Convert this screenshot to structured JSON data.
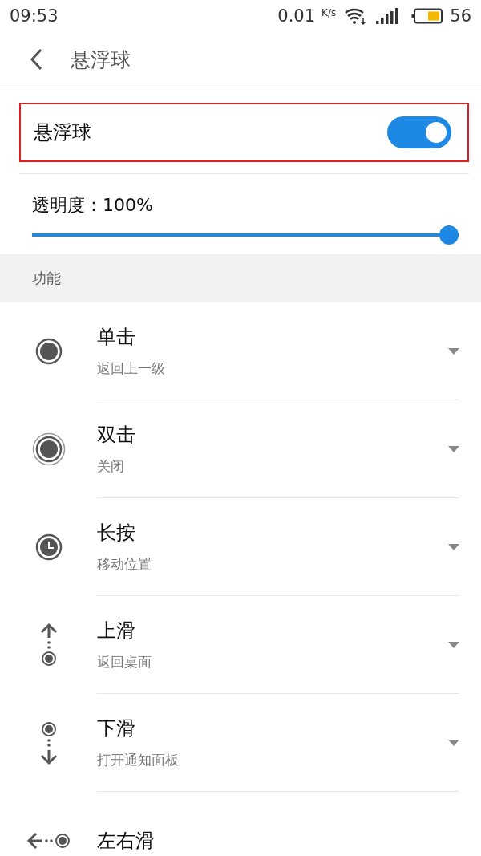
{
  "status_bar": {
    "time": "09:53",
    "speed": "0.01",
    "speed_unit": "K/s",
    "battery": "56"
  },
  "header": {
    "title": "悬浮球"
  },
  "toggle": {
    "label": "悬浮球",
    "on": true,
    "outlined": true
  },
  "opacity": {
    "label": "透明度：100%",
    "level": 1
  },
  "section": {
    "title": "功能"
  },
  "items": [
    {
      "kind": "tap",
      "title": "单击",
      "value": "返回上一级"
    },
    {
      "kind": "double",
      "title": "双击",
      "value": "关闭"
    },
    {
      "kind": "clock",
      "title": "长按",
      "value": "移动位置"
    },
    {
      "kind": "up",
      "title": "上滑",
      "value": "返回桌面"
    },
    {
      "kind": "down",
      "title": "下滑",
      "value": "打开通知面板"
    },
    {
      "kind": "sideways",
      "title": "左右滑"
    }
  ]
}
